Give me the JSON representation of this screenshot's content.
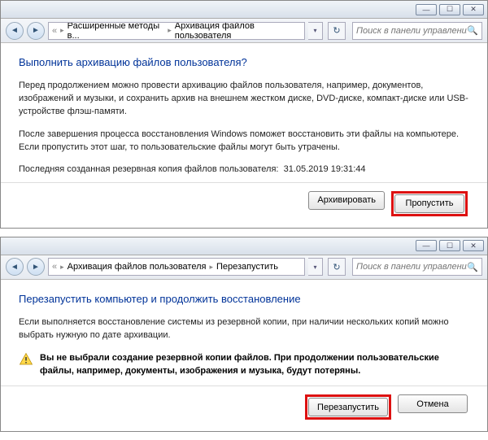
{
  "window1": {
    "breadcrumb": {
      "seg1": "Расширенные методы в...",
      "seg2": "Архивация файлов пользователя"
    },
    "search_placeholder": "Поиск в панели управления",
    "heading": "Выполнить архивацию файлов пользователя?",
    "para1": "Перед продолжением можно провести архивацию файлов пользователя, например, документов, изображений и музыки, и сохранить архив на внешнем жестком диске, DVD-диске, компакт-диске или USB-устройстве флэш-памяти.",
    "para2": "После завершения процесса восстановления Windows поможет восстановить эти файлы на компьютере. Если пропустить этот шаг, то пользовательские файлы могут быть утрачены.",
    "lastbackup_label": "Последняя созданная резервная копия файлов пользователя:",
    "lastbackup_value": "31.05.2019 19:31:44",
    "btn_archive": "Архивировать",
    "btn_skip": "Пропустить"
  },
  "window2": {
    "breadcrumb": {
      "seg1": "Архивация файлов пользователя",
      "seg2": "Перезапустить"
    },
    "search_placeholder": "Поиск в панели управления",
    "heading": "Перезапустить компьютер и продолжить восстановление",
    "para1": "Если выполняется восстановление системы из резервной копии, при наличии нескольких копий можно выбрать нужную по дате архивации.",
    "warning": "Вы не выбрали создание резервной копии файлов. При продолжении пользовательские файлы, например, документы, изображения и музыка, будут потеряны.",
    "btn_restart": "Перезапустить",
    "btn_cancel": "Отмена"
  },
  "titlebar_glyphs": {
    "min": "—",
    "max": "☐",
    "close": "✕"
  }
}
